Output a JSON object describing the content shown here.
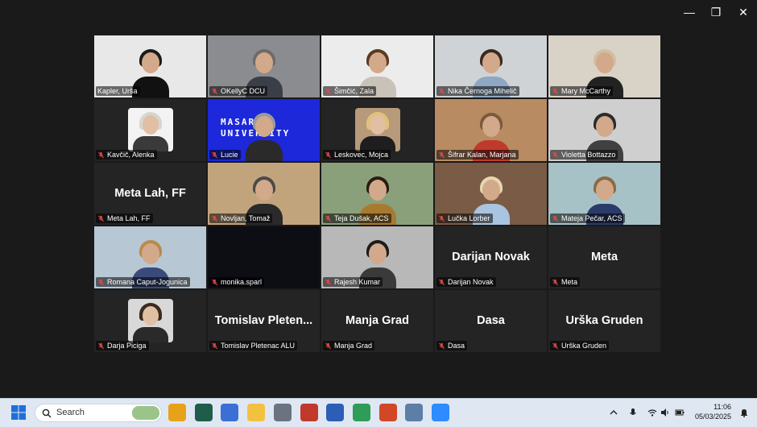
{
  "window": {
    "minimize_glyph": "—",
    "restore_glyph": "❐",
    "close_glyph": "✕"
  },
  "participants": [
    {
      "name": "Kapler, Urša",
      "type": "video",
      "active": true,
      "hair": "#1a1a1a",
      "shirt": "#111111",
      "bg": "#e8e8e8"
    },
    {
      "name": "OKellyC DCU",
      "type": "video",
      "hair": "#6d6b66",
      "shirt": "#3a3f47",
      "bg": "#8a8c90"
    },
    {
      "name": "Šimčić, Zala",
      "type": "video",
      "hair": "#5a3a22",
      "shirt": "#c8c2b8",
      "bg": "#ececec"
    },
    {
      "name": "Nika Černoga Mihelič",
      "type": "video",
      "hair": "#3b2a20",
      "shirt": "#8fa7c2",
      "bg": "#cfd3d6"
    },
    {
      "name": "Mary McCarthy",
      "type": "video",
      "hair": "#cfc0a0",
      "shirt": "#222222",
      "bg": "#d9d3c7"
    },
    {
      "name": "Kavčič, Alenka",
      "type": "photo",
      "hair": "#d8d5cf",
      "shirt": "#3a3a3a",
      "bg": "#f3f3f3"
    },
    {
      "name": "Lucie",
      "type": "banner",
      "banner": [
        "MASARYK",
        "UNIVERSITY"
      ]
    },
    {
      "name": "Leskovec, Mojca",
      "type": "photo",
      "hair": "#e3c07a",
      "shirt": "#1e1e1e",
      "bg": "#b69a7a"
    },
    {
      "name": "Šifrar Kalan, Marjana",
      "type": "video",
      "hair": "#7a5a3a",
      "shirt": "#c0392b",
      "bg": "#b88b62"
    },
    {
      "name": "Violetta Bottazzo",
      "type": "video",
      "hair": "#2c2c2c",
      "shirt": "#404040",
      "bg": "#cfcfcf"
    },
    {
      "name": "Meta Lah, FF",
      "type": "name",
      "bigname": "Meta Lah, FF"
    },
    {
      "name": "Novljan, Tomaž",
      "type": "video",
      "hair": "#4a4a4a",
      "shirt": "#2a2a2a",
      "bg": "#c2a47c"
    },
    {
      "name": "Teja Dušak, ACS",
      "type": "video",
      "hair": "#2a1c12",
      "shirt": "#a87a30",
      "bg": "#8aa07a"
    },
    {
      "name": "Lučka Lorber",
      "type": "video",
      "hair": "#e6d7b0",
      "shirt": "#a9c4e0",
      "bg": "#7a5b45"
    },
    {
      "name": "Mateja Pečar, ACS",
      "type": "video",
      "hair": "#8a6a45",
      "shirt": "#2a3a6a",
      "bg": "#a6c2c6"
    },
    {
      "name": "Romana Caput-Jogunica",
      "type": "video",
      "hair": "#b88a4a",
      "shirt": "#3a4a7a",
      "bg": "#b7c7d4"
    },
    {
      "name": "monika.sparl",
      "type": "video",
      "hair": "#0e0e18",
      "shirt": "#0e0e18",
      "bg": "#0d0d14",
      "dark": true
    },
    {
      "name": "Rajesh Kumar",
      "type": "video",
      "hair": "#1c1c1c",
      "shirt": "#3a3a3a",
      "bg": "#b8b8b8"
    },
    {
      "name": "Darijan Novak",
      "type": "name",
      "bigname": "Darijan Novak"
    },
    {
      "name": "Meta",
      "type": "name",
      "bigname": "Meta"
    },
    {
      "name": "Darja Piciga",
      "type": "photo",
      "hair": "#3a2a20",
      "shirt": "#2a2a2a",
      "bg": "#d8d8d8"
    },
    {
      "name": "Tomislav Pletenac ALU",
      "type": "name",
      "bigname": "Tomislav Pleten..."
    },
    {
      "name": "Manja Grad",
      "type": "name",
      "bigname": "Manja Grad"
    },
    {
      "name": "Dasa",
      "type": "name",
      "bigname": "Dasa"
    },
    {
      "name": "Urška Gruden",
      "type": "name",
      "bigname": "Urška Gruden"
    }
  ],
  "taskbar": {
    "search_label": "Search",
    "apps": [
      {
        "name": "chrome",
        "color": "#e8a21a"
      },
      {
        "name": "scrivener",
        "color": "#1f5d4a"
      },
      {
        "name": "teams",
        "color": "#3c6fd6"
      },
      {
        "name": "file-explorer",
        "color": "#f3c140"
      },
      {
        "name": "settings",
        "color": "#6b7280"
      },
      {
        "name": "zotero",
        "color": "#c0392b"
      },
      {
        "name": "word",
        "color": "#2b5fb6"
      },
      {
        "name": "chrome-profile",
        "color": "#2e9d57"
      },
      {
        "name": "powerpoint",
        "color": "#d24726"
      },
      {
        "name": "snipping-tool",
        "color": "#5b7fa6"
      },
      {
        "name": "zoom",
        "color": "#2d8cff"
      }
    ],
    "time": "11:06",
    "date": "05/03/2025"
  }
}
